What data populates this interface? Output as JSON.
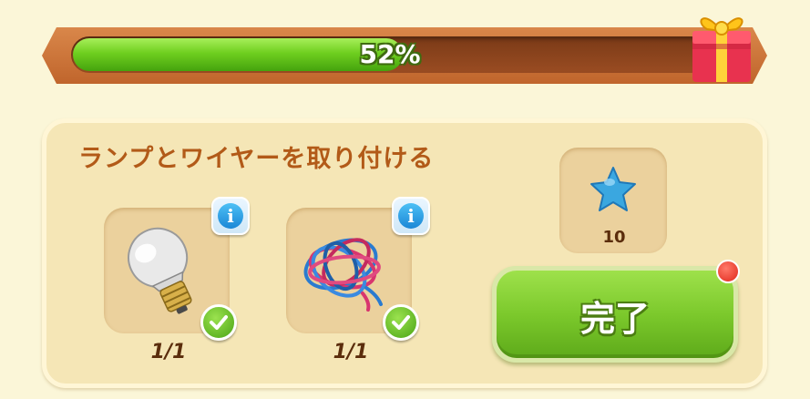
{
  "progress": {
    "percent_label": "52%",
    "fraction": 0.52
  },
  "task": {
    "title": "ランプとワイヤーを取り付ける",
    "items": [
      {
        "name": "light-bulb",
        "icon": "light-bulb-icon",
        "count": "1/1",
        "completed": true
      },
      {
        "name": "wire-bundle",
        "icon": "wire-bundle-icon",
        "count": "1/1",
        "completed": true
      }
    ],
    "reward": {
      "icon": "blue-star-icon",
      "amount": "10"
    },
    "complete_label": "完了"
  },
  "colors": {
    "progress_green": "#6fcf1f",
    "title_brown": "#b25a18",
    "button_green": "#7cc92c",
    "notify_red": "#e0261a"
  }
}
